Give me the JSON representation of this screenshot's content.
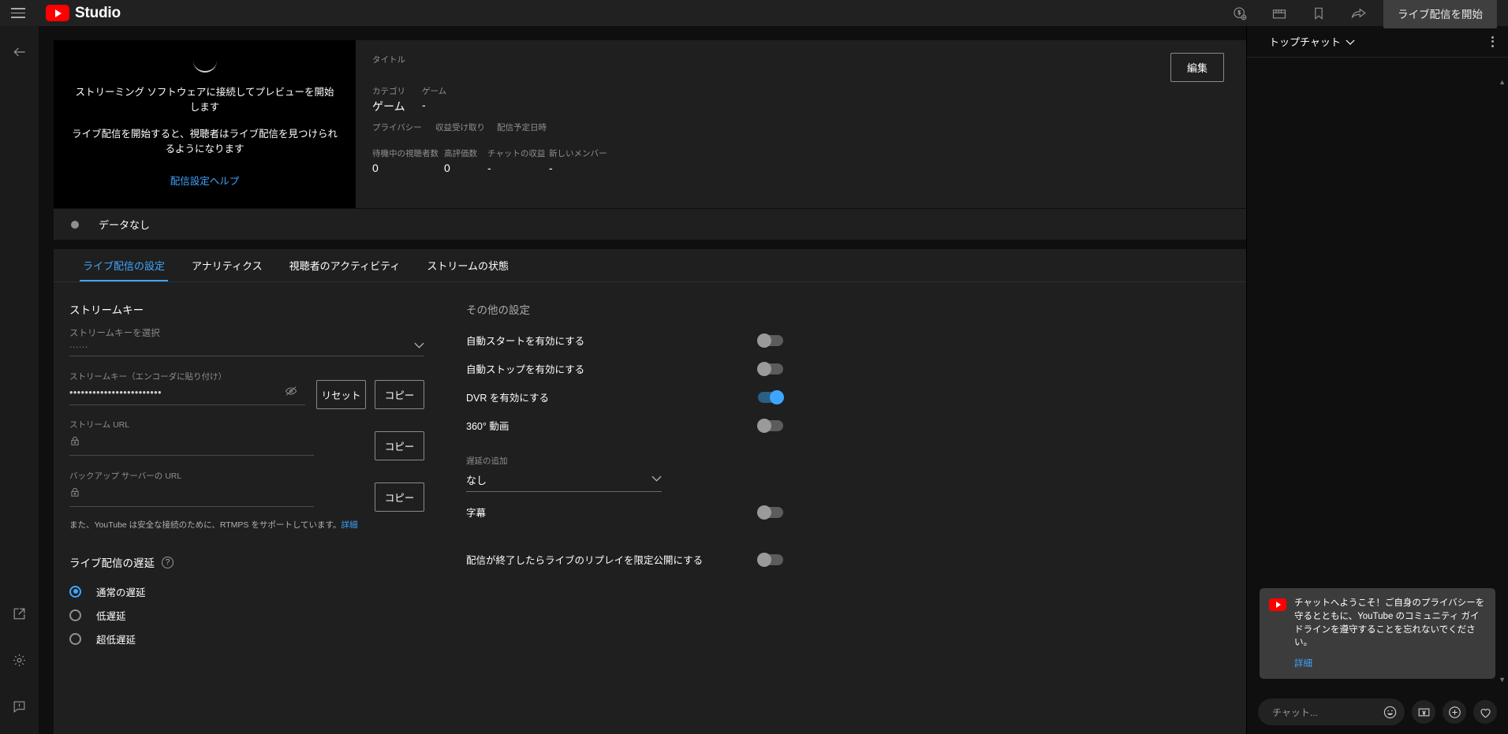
{
  "topbar": {
    "menu_icon": "hamburger-menu-icon",
    "brand": "Studio",
    "icons": [
      {
        "name": "monetization-icon",
        "label": "$"
      },
      {
        "name": "clapperboard-icon",
        "label": ""
      },
      {
        "name": "bookmark-icon",
        "label": ""
      },
      {
        "name": "share-icon",
        "label": ""
      }
    ],
    "go_live_label": "ライブ配信を開始"
  },
  "rail": {
    "back_icon": "back-arrow-icon",
    "external_icon": "external-link-icon",
    "settings_icon": "gear-icon",
    "feedback_icon": "feedback-icon"
  },
  "preview": {
    "line1": "ストリーミング ソフトウェアに接続してプレビューを開始します",
    "line2": "ライブ配信を開始すると、視聴者はライブ配信を見つけられるようになります",
    "help_link": "配信設定ヘルプ"
  },
  "meta": {
    "title_label": "タイトル",
    "title_value": "",
    "category_label": "カテゴリ",
    "category_value": "ゲーム",
    "game_label": "ゲーム",
    "game_value": "-",
    "privacy_label": "プライバシー",
    "privacy_value": "",
    "monetization_label": "収益受け取り",
    "monetization_value": "",
    "schedule_label": "配信予定日時",
    "schedule_value": "",
    "edit_label": "編集",
    "stats": [
      {
        "label": "待機中の視聴者数",
        "value": "0"
      },
      {
        "label": "高評価数",
        "value": "0"
      },
      {
        "label": "チャットの収益",
        "value": "-"
      },
      {
        "label": "新しいメンバー",
        "value": "-"
      }
    ]
  },
  "status": {
    "text": "データなし"
  },
  "tabs": [
    {
      "label": "ライブ配信の設定",
      "active": true
    },
    {
      "label": "アナリティクス",
      "active": false
    },
    {
      "label": "視聴者のアクティビティ",
      "active": false
    },
    {
      "label": "ストリームの状態",
      "active": false
    }
  ],
  "stream_key": {
    "section_title": "ストリームキー",
    "select_label": "ストリームキーを選択",
    "select_value": "......",
    "key_label": "ストリームキー（エンコーダに貼り付け）",
    "key_value": "••••••••••••••••••••••••",
    "reset_label": "リセット",
    "copy_label": "コピー",
    "stream_url_label": "ストリーム URL",
    "stream_url_value": "",
    "backup_url_label": "バックアップ サーバーの URL",
    "backup_url_value": "",
    "note_text": "また、YouTube は安全な接続のために、RTMPS をサポートしています。",
    "note_link": "詳細"
  },
  "latency": {
    "title": "ライブ配信の遅延",
    "help_icon": "help-icon",
    "options": [
      {
        "label": "通常の遅延",
        "selected": true
      },
      {
        "label": "低遅延",
        "selected": false
      },
      {
        "label": "超低遅延",
        "selected": false
      }
    ]
  },
  "other_settings": {
    "title": "その他の設定",
    "toggles_top": [
      {
        "label": "自動スタートを有効にする",
        "on": false
      },
      {
        "label": "自動ストップを有効にする",
        "on": false
      },
      {
        "label": "DVR を有効にする",
        "on": true
      },
      {
        "label": "360° 動画",
        "on": false
      }
    ],
    "delay_label": "遅延の追加",
    "delay_value": "なし",
    "toggles_bottom": [
      {
        "label": "字幕",
        "on": false
      },
      {
        "label": "配信が終了したらライブのリプレイを限定公開にする",
        "on": false
      }
    ]
  },
  "chat": {
    "header_title": "トップチャット",
    "welcome_text": "チャットへようこそ！ご自身のプライバシーを守るとともに、YouTube のコミュニティ ガイドラインを遵守することを忘れないでください。",
    "welcome_link": "詳細",
    "input_placeholder": "チャット...",
    "emoji_icon": "emoji-icon",
    "superchat_icon": "superchat-yen-icon",
    "plus_icon": "plus-icon",
    "heart_icon": "heart-icon"
  },
  "colors": {
    "accent": "#3ea6ff",
    "brand_red": "#ff0000",
    "panel": "#1f1f1f",
    "bg": "#0f0f0f"
  }
}
